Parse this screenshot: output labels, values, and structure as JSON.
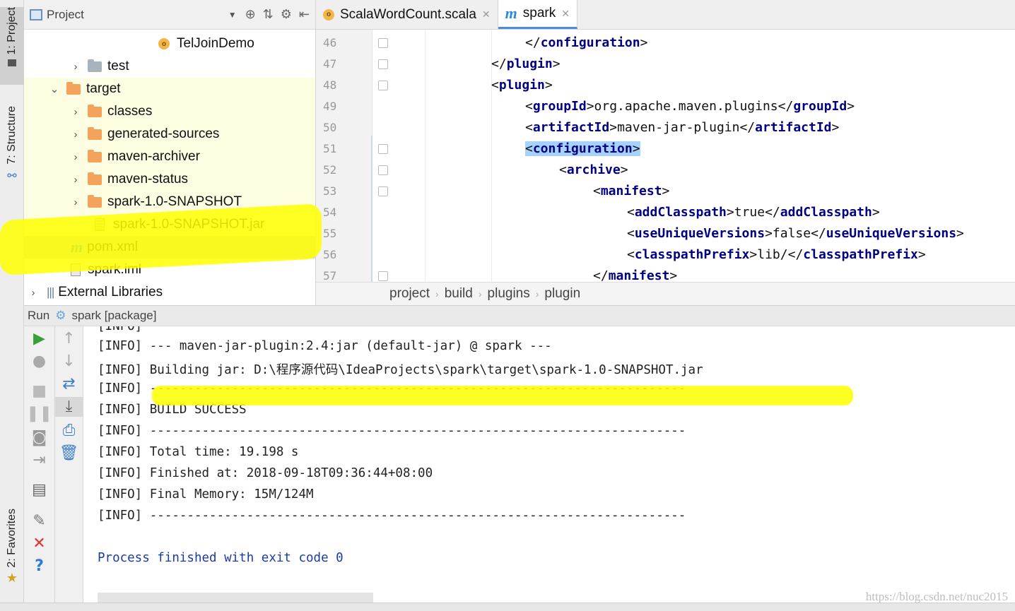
{
  "sidebar": {
    "project_tab": "1: Project",
    "structure_tab": "7: Structure",
    "favorites_tab": "2: Favorites"
  },
  "project_panel": {
    "title": "Project",
    "items": [
      {
        "label": "TelJoinDemo",
        "icon": "scala-object-icon"
      },
      {
        "label": "test",
        "icon": "folder-icon"
      },
      {
        "label": "target",
        "icon": "folder-icon",
        "expanded": true
      },
      {
        "label": "classes",
        "icon": "folder-icon"
      },
      {
        "label": "generated-sources",
        "icon": "folder-icon"
      },
      {
        "label": "maven-archiver",
        "icon": "folder-icon"
      },
      {
        "label": "maven-status",
        "icon": "folder-icon"
      },
      {
        "label": "spark-1.0-SNAPSHOT",
        "icon": "folder-icon"
      },
      {
        "label": "spark-1.0-SNAPSHOT.jar",
        "icon": "jar-icon"
      },
      {
        "label": "pom.xml",
        "icon": "maven-icon"
      },
      {
        "label": "spark.iml",
        "icon": "iml-file-icon"
      },
      {
        "label": "External Libraries",
        "icon": "libraries-icon"
      }
    ]
  },
  "editor": {
    "tabs": [
      {
        "label": "ScalaWordCount.scala",
        "active": false
      },
      {
        "label": "spark",
        "active": true
      }
    ],
    "lines": [
      {
        "num": "46",
        "open": "</",
        "tag": "configuration",
        "close": ">",
        "text": "",
        "etag": ""
      },
      {
        "num": "47",
        "open": "</",
        "tag": "plugin",
        "close": ">",
        "text": "",
        "etag": ""
      },
      {
        "num": "48",
        "open": "<",
        "tag": "plugin",
        "close": ">",
        "text": "",
        "etag": ""
      },
      {
        "num": "49",
        "open": "<",
        "tag": "groupId",
        "close": ">",
        "text": "org.apache.maven.plugins",
        "etag": "groupId"
      },
      {
        "num": "50",
        "open": "<",
        "tag": "artifactId",
        "close": ">",
        "text": "maven-jar-plugin",
        "etag": "artifactId"
      },
      {
        "num": "51",
        "open": "<",
        "tag": "configuration",
        "close": ">",
        "text": "",
        "etag": ""
      },
      {
        "num": "52",
        "open": "<",
        "tag": "archive",
        "close": ">",
        "text": "",
        "etag": ""
      },
      {
        "num": "53",
        "open": "<",
        "tag": "manifest",
        "close": ">",
        "text": "",
        "etag": ""
      },
      {
        "num": "54",
        "open": "<",
        "tag": "addClasspath",
        "close": ">",
        "text": "true",
        "etag": "addClasspath"
      },
      {
        "num": "55",
        "open": "<",
        "tag": "useUniqueVersions",
        "close": ">",
        "text": "false",
        "etag": "useUniqueVersions"
      },
      {
        "num": "56",
        "open": "<",
        "tag": "classpathPrefix",
        "close": ">",
        "text": "lib/",
        "etag": "classpathPrefix"
      },
      {
        "num": "57",
        "open": "</",
        "tag": "manifest",
        "close": ">",
        "text": "",
        "etag": ""
      }
    ],
    "breadcrumbs": [
      "project",
      "build",
      "plugins",
      "plugin"
    ]
  },
  "run_panel": {
    "label": "Run",
    "config": "spark [package]",
    "console": [
      "[INFO] --- maven-jar-plugin:2.4:jar (default-jar) @ spark ---",
      "[INFO] Building jar: D:\\程序源代码\\IdeaProjects\\spark\\target\\spark-1.0-SNAPSHOT.jar",
      "[INFO] ------------------------------------------------------------------------",
      "[INFO] BUILD SUCCESS",
      "[INFO] ------------------------------------------------------------------------",
      "[INFO] Total time: 19.198 s",
      "[INFO] Finished at: 2018-09-18T09:36:44+08:00",
      "[INFO] Final Memory: 15M/124M",
      "[INFO] ------------------------------------------------------------------------",
      "",
      "Process finished with exit code 0"
    ],
    "cut_line": "[INFO]"
  },
  "watermark": "https://blog.csdn.net/nuc2015",
  "colors": {
    "tag": "#000080",
    "highlight": "#a6d2ff",
    "exit_text": "#1a3aa8",
    "marker": "#ffff00"
  }
}
